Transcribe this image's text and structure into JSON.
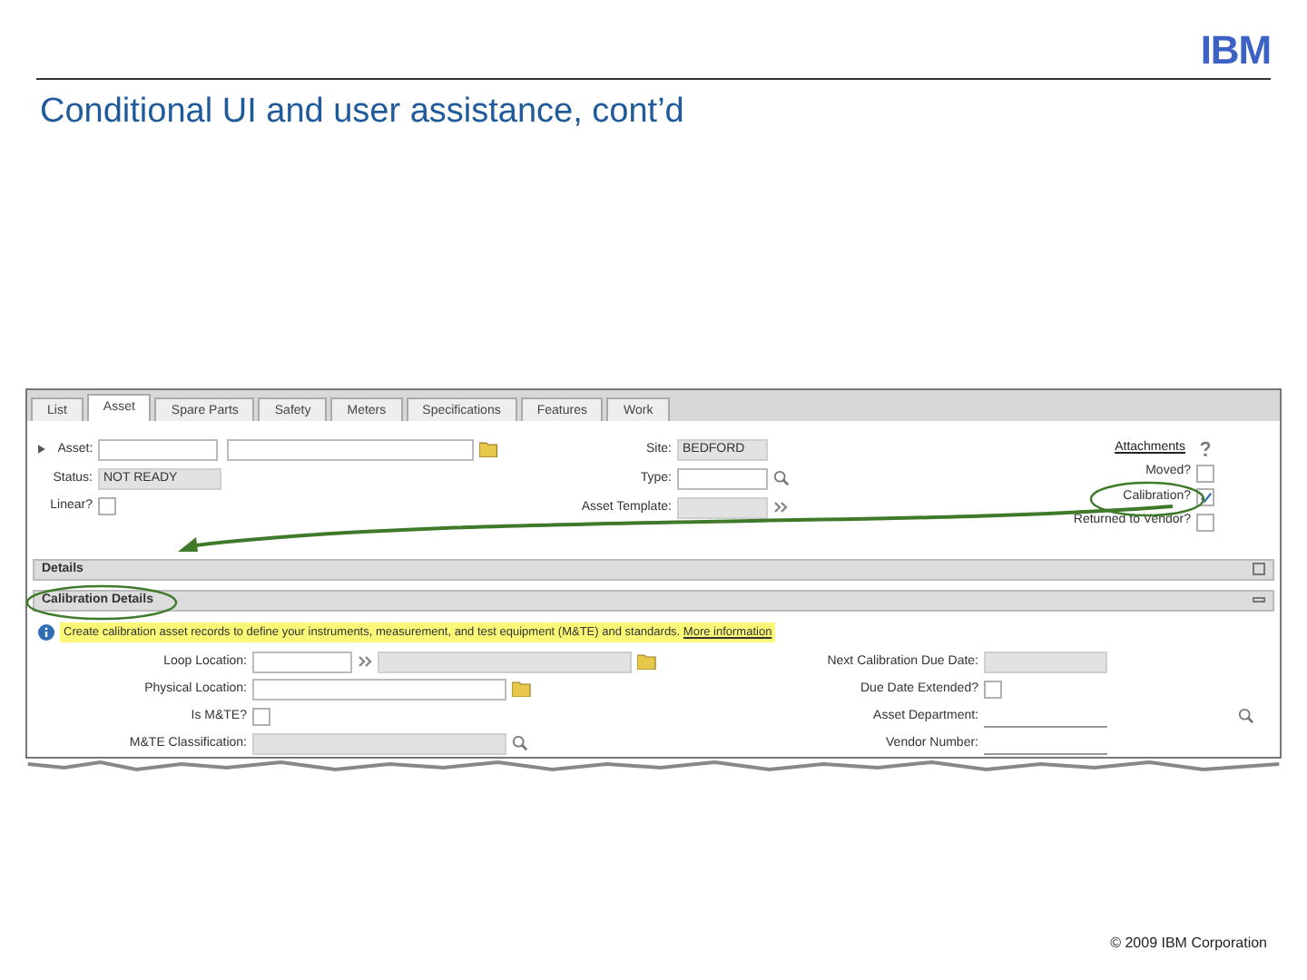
{
  "slide": {
    "logo": "IBM",
    "title": "Conditional UI and user assistance, cont’d",
    "footer": "© 2009 IBM Corporation"
  },
  "app": {
    "tabs": [
      {
        "label": "List",
        "selected": false
      },
      {
        "label": "Asset",
        "selected": true
      },
      {
        "label": "Spare Parts",
        "selected": false
      },
      {
        "label": "Safety",
        "selected": false
      },
      {
        "label": "Meters",
        "selected": false
      },
      {
        "label": "Specifications",
        "selected": false
      },
      {
        "label": "Features",
        "selected": false
      },
      {
        "label": "Work",
        "selected": false
      }
    ],
    "asset_left": [
      {
        "label": "Asset:",
        "kind": "text",
        "required": true
      },
      {
        "label": "Status:",
        "kind": "readonly",
        "value": "NOT READY"
      },
      {
        "label": "Linear?",
        "kind": "checkbox",
        "checked": false
      }
    ],
    "asset_middle": [
      {
        "label": "Site:",
        "kind": "readonly",
        "value": "BEDFORD"
      },
      {
        "label": "Type:",
        "kind": "text"
      },
      {
        "label": "Asset Template:",
        "kind": "readonly"
      }
    ],
    "attachments_link": "Attachments",
    "asset_right": [
      {
        "label": "Moved?",
        "checked": false
      },
      {
        "label": "Calibration?",
        "checked": true
      },
      {
        "label": "Returned to Vendor?",
        "checked": false
      }
    ],
    "sections": [
      {
        "title": "Details",
        "expanded": false
      },
      {
        "title": "Calibration Details",
        "expanded": true
      }
    ],
    "info": {
      "text": "Create calibration asset records to define your instruments, measurement, and test equipment (M&TE) and standards.",
      "link": "More information"
    },
    "calibration_left": [
      {
        "label": "Loop Location:",
        "kind": "text"
      },
      {
        "label": "Physical Location:",
        "kind": "text"
      },
      {
        "label": "Is M&TE?",
        "kind": "checkbox",
        "checked": false
      },
      {
        "label": "M&TE Classification:",
        "kind": "readonly"
      }
    ],
    "calibration_right": [
      {
        "label": "Next Calibration Due Date:",
        "kind": "readonly"
      },
      {
        "label": "Due Date Extended?",
        "kind": "checkbox",
        "checked": false
      },
      {
        "label": "Asset Department:",
        "kind": "underline"
      },
      {
        "label": "Vendor Number:",
        "kind": "underline"
      }
    ]
  }
}
